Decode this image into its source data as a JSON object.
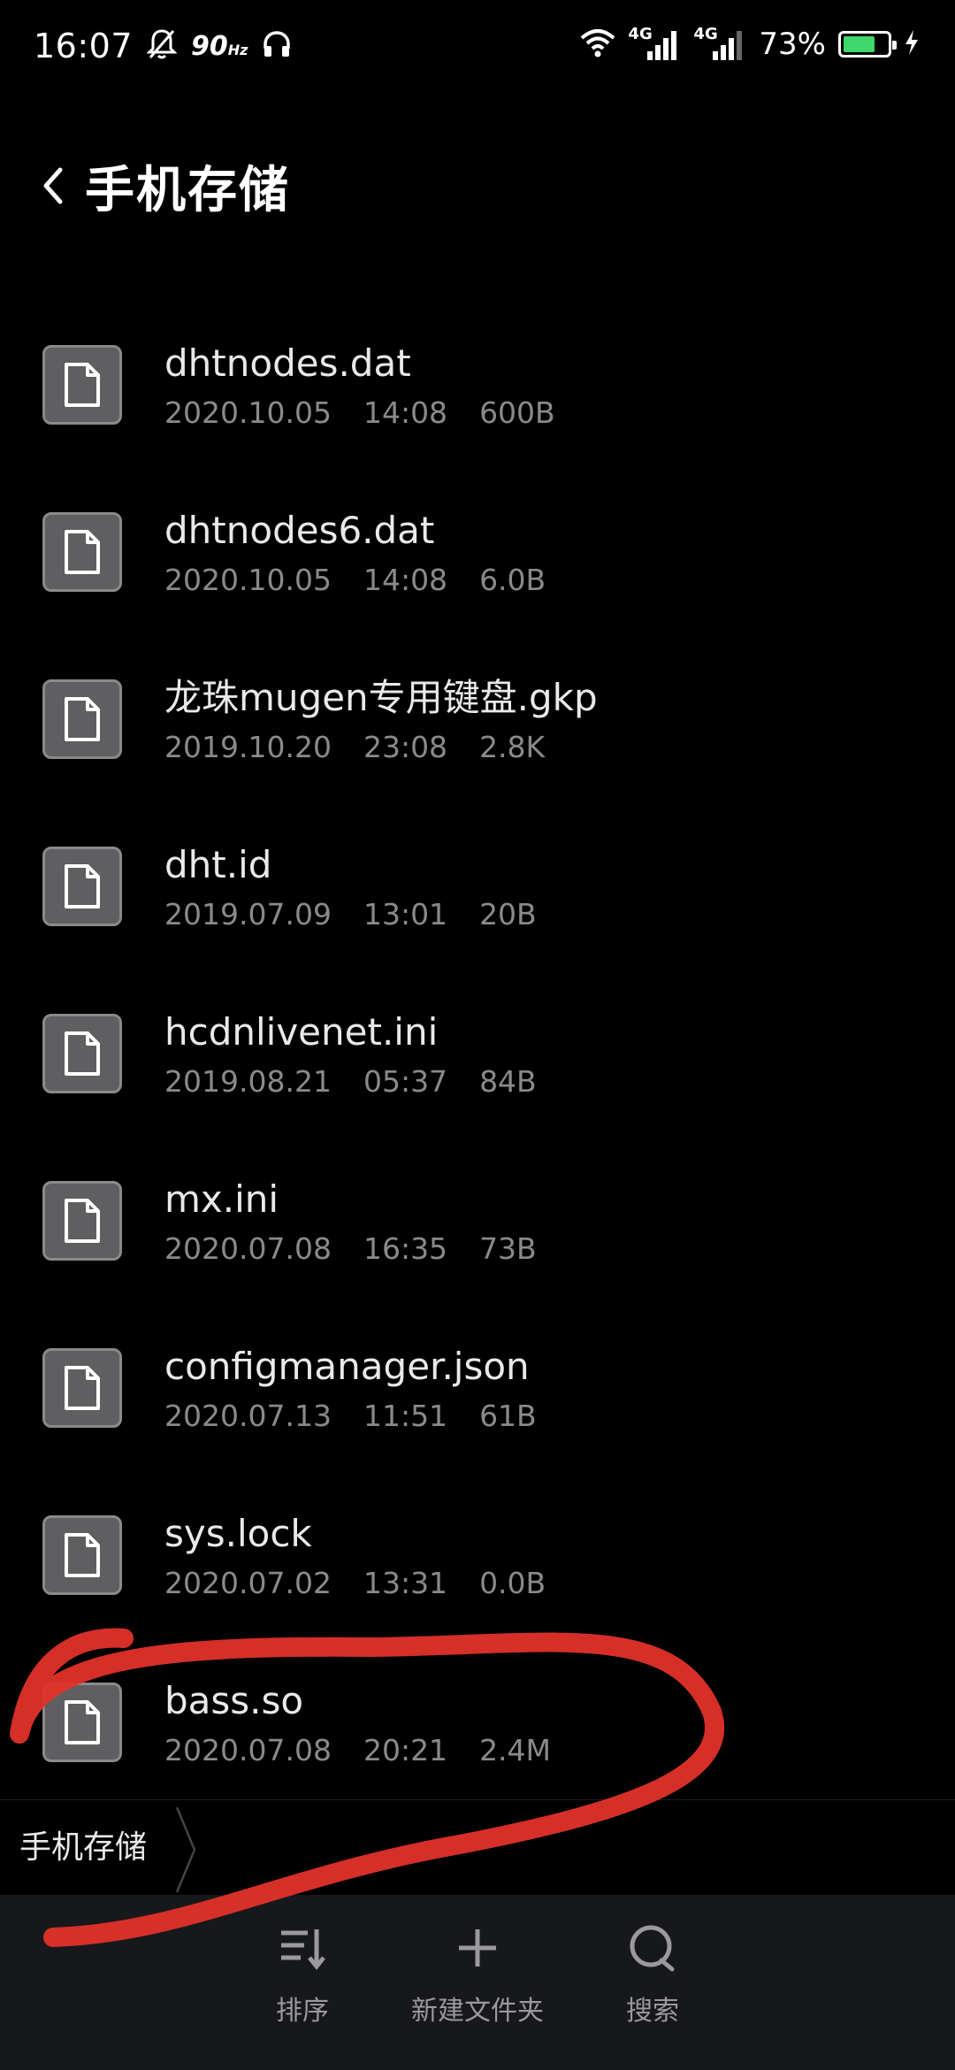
{
  "status_bar": {
    "time": "16:07",
    "refresh_rate": "90",
    "refresh_unit": "Hz",
    "network_1": "4G",
    "network_2": "4G",
    "battery_percent": "73%",
    "battery_level": 0.73,
    "icons": [
      "bell-off-icon",
      "headphones-icon",
      "wifi-icon",
      "signal-icon",
      "battery-icon",
      "charging-icon"
    ]
  },
  "header": {
    "title": "手机存储"
  },
  "files": [
    {
      "name": "dhtnodes.dat",
      "date": "2020.10.05",
      "time": "14:08",
      "size": "600B"
    },
    {
      "name": "dhtnodes6.dat",
      "date": "2020.10.05",
      "time": "14:08",
      "size": "6.0B"
    },
    {
      "name": "龙珠mugen专用键盘.gkp",
      "date": "2019.10.20",
      "time": "23:08",
      "size": "2.8K"
    },
    {
      "name": "dht.id",
      "date": "2019.07.09",
      "time": "13:01",
      "size": "20B"
    },
    {
      "name": "hcdnlivenet.ini",
      "date": "2019.08.21",
      "time": "05:37",
      "size": "84B"
    },
    {
      "name": "mx.ini",
      "date": "2020.07.08",
      "time": "16:35",
      "size": "73B"
    },
    {
      "name": "configmanager.json",
      "date": "2020.07.13",
      "time": "11:51",
      "size": "61B"
    },
    {
      "name": "sys.lock",
      "date": "2020.07.02",
      "time": "13:31",
      "size": "0.0B"
    },
    {
      "name": "bass.so",
      "date": "2020.07.08",
      "time": "20:21",
      "size": "2.4M"
    }
  ],
  "breadcrumb": {
    "current": "手机存储"
  },
  "toolbar": {
    "sort_label": "排序",
    "new_folder_label": "新建文件夹",
    "search_label": "搜索"
  },
  "colors": {
    "background": "#000000",
    "toolbar_bg": "#17181b",
    "file_icon_bg": "#5f5f61",
    "meta_text": "#8a8a8a",
    "battery_green": "#3fd66a",
    "annotation_red": "#e0322a"
  }
}
